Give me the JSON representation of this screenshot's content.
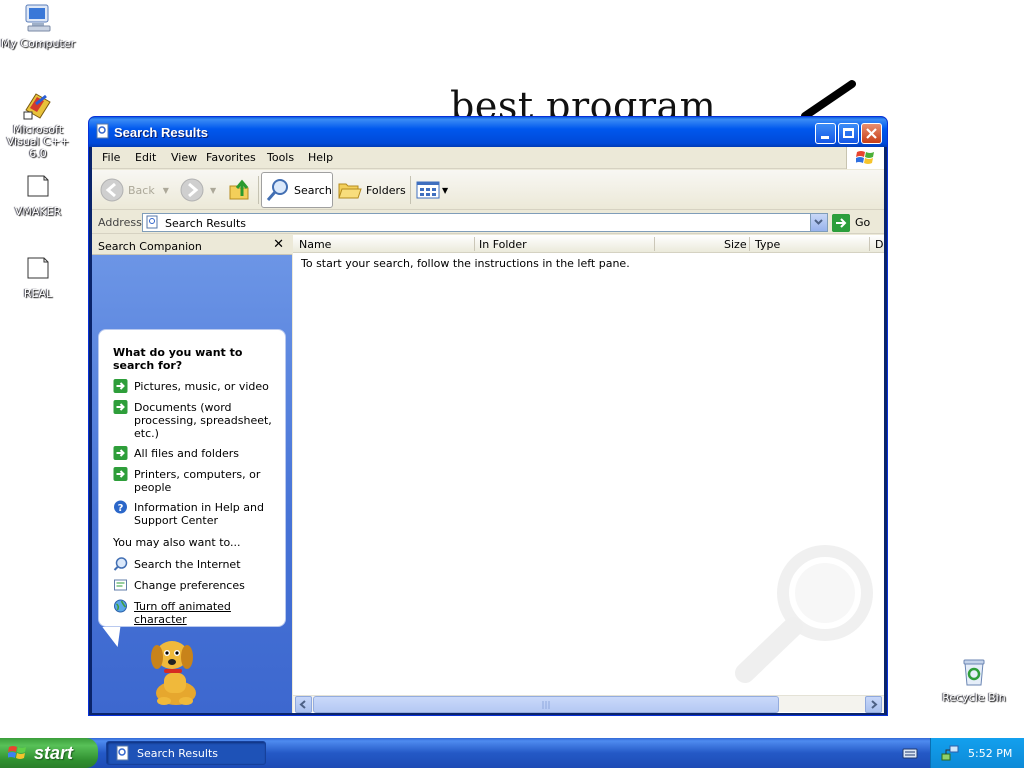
{
  "desktop": {
    "icons": [
      {
        "label": "My Computer"
      },
      {
        "label": "Microsoft Visual C++ 6.0"
      },
      {
        "label": "VMAKER"
      },
      {
        "label": "REAL"
      },
      {
        "label": "Recycle Bin"
      }
    ],
    "wallpaper_text": "best program"
  },
  "window": {
    "title": "Search Results",
    "menu": [
      "File",
      "Edit",
      "View",
      "Favorites",
      "Tools",
      "Help"
    ],
    "toolbar": {
      "back": "Back",
      "search": "Search",
      "folders": "Folders"
    },
    "address": {
      "label": "Address",
      "value": "Search Results",
      "go": "Go"
    }
  },
  "companion": {
    "header": "Search Companion",
    "question": "What do you want to search for?",
    "options": [
      {
        "label": "Pictures, music, or video",
        "icon": "green-arrow-icon"
      },
      {
        "label": "Documents (word processing, spreadsheet, etc.)",
        "icon": "green-arrow-icon"
      },
      {
        "label": "All files and folders",
        "icon": "green-arrow-icon"
      },
      {
        "label": "Printers, computers, or people",
        "icon": "green-arrow-icon"
      },
      {
        "label": "Information in Help and Support Center",
        "icon": "help-icon"
      }
    ],
    "also_label": "You may also want to...",
    "also": [
      {
        "label": "Search the Internet",
        "icon": "search-internet-icon"
      },
      {
        "label": "Change preferences",
        "icon": "preferences-icon"
      },
      {
        "label": "Turn off animated character",
        "icon": "globe-icon"
      }
    ]
  },
  "results": {
    "columns": [
      "Name",
      "In Folder",
      "Size",
      "Type",
      "D"
    ],
    "empty_message": "To start your search, follow the instructions in the left pane."
  },
  "taskbar": {
    "start": "start",
    "task_label": "Search Results",
    "clock": "5:52 PM"
  },
  "colors": {
    "titlebar": "#0058ee",
    "taskbar": "#2459c6",
    "start": "#3b9e3b",
    "pane": "#4773d6"
  }
}
